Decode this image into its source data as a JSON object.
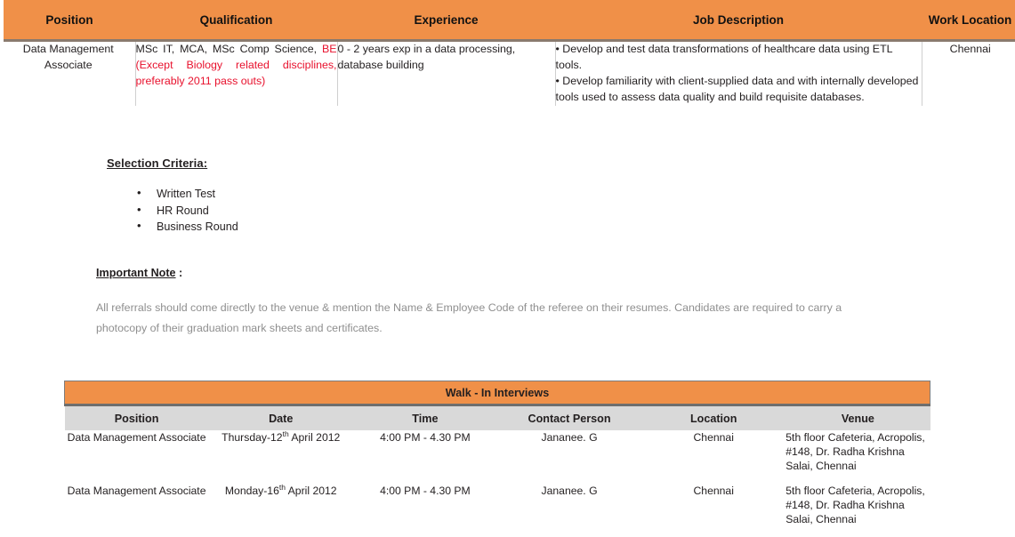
{
  "job_table": {
    "headers": [
      {
        "label": "Position"
      },
      {
        "label": "Qualification"
      },
      {
        "label": "Experience"
      },
      {
        "label": "Job Description"
      },
      {
        "label": "Work Location"
      }
    ],
    "rows": [
      {
        "position": "Data Management Associate",
        "qualification_plain": "MSc IT, MCA, MSc Comp Science, ",
        "qualification_red": "BE (Except Biology related disciplines, preferably 2011 pass outs)",
        "experience": "0 - 2 years exp in a data processing, database building",
        "job_description": [
          "• Develop and test data transformations of healthcare data using ETL tools.",
          "• Develop familiarity with client-supplied data and with internally developed tools used to assess data quality and build requisite databases."
        ],
        "work_location": "Chennai"
      }
    ]
  },
  "selection_criteria": {
    "heading": "Selection Criteria:",
    "items": [
      {
        "label": "Written Test"
      },
      {
        "label": "HR Round"
      },
      {
        "label": "Business Round"
      }
    ]
  },
  "important_note": {
    "heading": "Important Note",
    "heading_suffix": " :",
    "body": "All referrals should come directly to the venue & mention the Name & Employee Code of the referee on their resumes. Candidates are required to carry a photocopy of their graduation mark sheets and certificates."
  },
  "walkin": {
    "title": "Walk - In Interviews",
    "headers": [
      {
        "label": "Position"
      },
      {
        "label": "Date"
      },
      {
        "label": "Time"
      },
      {
        "label": "Contact Person"
      },
      {
        "label": "Location"
      },
      {
        "label": "Venue"
      }
    ],
    "rows": [
      {
        "position": "Data Management Associate",
        "date_prefix": "Thursday-12",
        "date_sup": "th",
        "date_suffix": " April 2012",
        "time": "4:00 PM - 4.30 PM",
        "contact_person": "Jananee. G",
        "location": "Chennai",
        "venue": "5th floor Cafeteria, Acropolis, #148, Dr. Radha Krishna Salai, Chennai"
      },
      {
        "position": "Data Management Associate",
        "date_prefix": "Monday-16",
        "date_sup": "th",
        "date_suffix": " April 2012",
        "time": "4:00 PM - 4.30 PM",
        "contact_person": "Jananee. G",
        "location": "Chennai",
        "venue": "5th floor Cafeteria, Acropolis, #148, Dr. Radha Krishna Salai, Chennai"
      }
    ]
  },
  "colors": {
    "header_orange": "#F09048",
    "subheader_gray": "#D9D9D9",
    "red_text": "#e8112d",
    "note_gray": "#8f8f8f",
    "body_text": "#231f20"
  }
}
